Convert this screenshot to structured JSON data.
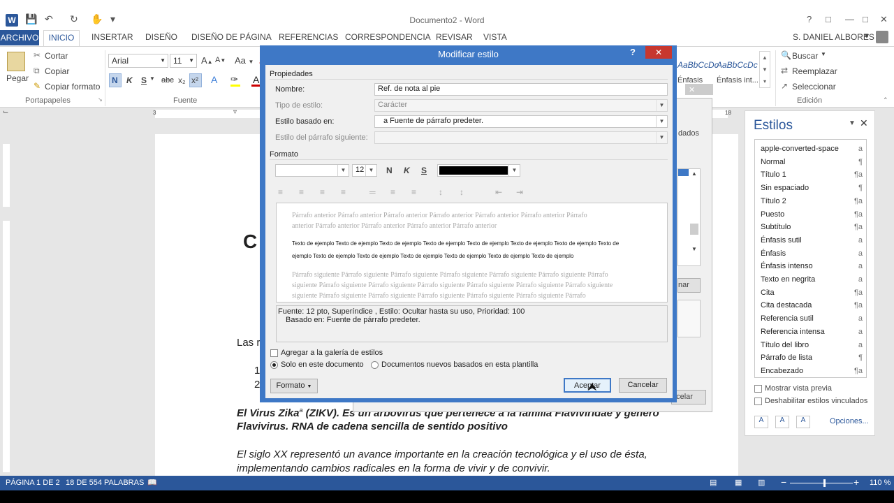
{
  "app": {
    "title": "Documento2 - Word",
    "user": "S. DANIEL ALBORES"
  },
  "tabs": [
    "ARCHIVO",
    "INICIO",
    "INSERTAR",
    "DISEÑO",
    "DISEÑO DE PÁGINA",
    "REFERENCIAS",
    "CORRESPONDENCIA",
    "REVISAR",
    "VISTA"
  ],
  "ribbon": {
    "paste": "Pegar",
    "cut": "Cortar",
    "copy": "Copiar",
    "format_painter": "Copiar formato",
    "group_clipboard": "Portapapeles",
    "group_font": "Fuente",
    "group_edit": "Edición",
    "font_name": "Arial",
    "font_size": "11",
    "find": "Buscar",
    "replace": "Reemplazar",
    "select": "Seleccionar",
    "style_prev1": "AaBbCcDc",
    "style_prev2": "AaBbCcDc",
    "style_lbl1": "Énfasis",
    "style_lbl2": "Énfasis int...",
    "bold": "N",
    "italic": "K",
    "underline": "S",
    "strike": "abc",
    "subscript": "x₂",
    "superscript": "x²",
    "grow": "A",
    "aa": "Aa"
  },
  "document": {
    "heading_letter": "C",
    "para1": "Las r",
    "list1": "1",
    "list2": "2",
    "zika_line1_a": "El Virus Zika",
    "zika_mark": "a",
    "zika_line1_b": " (ZIKV). Es un arbovirus que pertenece a la familia Flaviviridae y genero",
    "zika_line2": "Flavivirus. RNA de cadena sencilla de sentido positivo",
    "xx_line1": "El siglo XX representó un avance importante en la creación tecnológica y el uso de ésta,",
    "xx_line2": "implementando cambios radicales en la forma de vivir y de convivir."
  },
  "behind_dialog": {
    "text1": "dados",
    "btn1": "nar",
    "btn2": "ncelar"
  },
  "dialog": {
    "title": "Modificar estilo",
    "section_props": "Propiedades",
    "name_label": "Nombre:",
    "name_value": "Ref. de nota al pie",
    "type_label": "Tipo de estilo:",
    "type_value": "Carácter",
    "based_label": "Estilo basado en:",
    "based_value": "Fuente de párrafo predeter.",
    "based_icon": "a",
    "next_label": "Estilo del párrafo siguiente:",
    "section_format": "Formato",
    "font_size": "12",
    "bold": "N",
    "italic": "K",
    "underline": "S",
    "font_color": "#000000",
    "preview_prev1": "Párrafo anterior Párrafo anterior Párrafo anterior Párrafo anterior Párrafo anterior Párrafo anterior Párrafo",
    "preview_prev2": "anterior Párrafo anterior Párrafo anterior Párrafo anterior Párrafo anterior",
    "preview_sample1": "Texto de ejemplo Texto de ejemplo Texto de ejemplo Texto de ejemplo Texto de ejemplo Texto de ejemplo Texto de ejemplo Texto de",
    "preview_sample2": "ejemplo Texto de ejemplo Texto de ejemplo Texto de ejemplo Texto de ejemplo Texto de ejemplo Texto de ejemplo",
    "preview_next1": "Párrafo siguiente Párrafo siguiente Párrafo siguiente Párrafo siguiente Párrafo siguiente Párrafo siguiente Párrafo",
    "preview_next2": "siguiente Párrafo siguiente Párrafo siguiente Párrafo siguiente Párrafo siguiente Párrafo siguiente Párrafo siguiente",
    "preview_next3": "siguiente Párrafo siguiente Párrafo siguiente Párrafo siguiente Párrafo siguiente Párrafo siguiente Párrafo",
    "desc1": "Fuente: 12 pto, Superíndice , Estilo: Ocultar hasta su uso, Prioridad: 100",
    "desc2": "Basado en: Fuente de párrafo predeter.",
    "add_gallery": "Agregar a la galería de estilos",
    "only_doc": "Solo en este documento",
    "new_docs": "Documentos nuevos basados en esta plantilla",
    "format_btn": "Formato",
    "ok": "Aceptar",
    "cancel": "Cancelar",
    "help": "?",
    "close": "✕"
  },
  "styles_pane": {
    "title": "Estilos",
    "items": [
      {
        "name": "apple-converted-space",
        "sym": "a"
      },
      {
        "name": "Normal",
        "sym": "¶"
      },
      {
        "name": "Título 1",
        "sym": "¶a"
      },
      {
        "name": "Sin espaciado",
        "sym": "¶"
      },
      {
        "name": "Título 2",
        "sym": "¶a"
      },
      {
        "name": "Puesto",
        "sym": "¶a"
      },
      {
        "name": "Subtítulo",
        "sym": "¶a"
      },
      {
        "name": "Énfasis sutil",
        "sym": "a"
      },
      {
        "name": "Énfasis",
        "sym": "a"
      },
      {
        "name": "Énfasis intenso",
        "sym": "a"
      },
      {
        "name": "Texto en negrita",
        "sym": "a"
      },
      {
        "name": "Cita",
        "sym": "¶a"
      },
      {
        "name": "Cita destacada",
        "sym": "¶a"
      },
      {
        "name": "Referencia sutil",
        "sym": "a"
      },
      {
        "name": "Referencia intensa",
        "sym": "a"
      },
      {
        "name": "Título del libro",
        "sym": "a"
      },
      {
        "name": "Párrafo de lista",
        "sym": "¶"
      },
      {
        "name": "Encabezado",
        "sym": "¶a"
      }
    ],
    "show_preview": "Mostrar vista previa",
    "disable_linked": "Deshabilitar estilos vinculados",
    "options": "Opciones..."
  },
  "status": {
    "page": "PÁGINA 1 DE 2",
    "words": "18 DE 554 PALABRAS",
    "zoom": "110 %"
  },
  "colors": {
    "accent": "#2b579a",
    "dialog_frame": "#3e78c6",
    "close_red": "#c7372f"
  }
}
